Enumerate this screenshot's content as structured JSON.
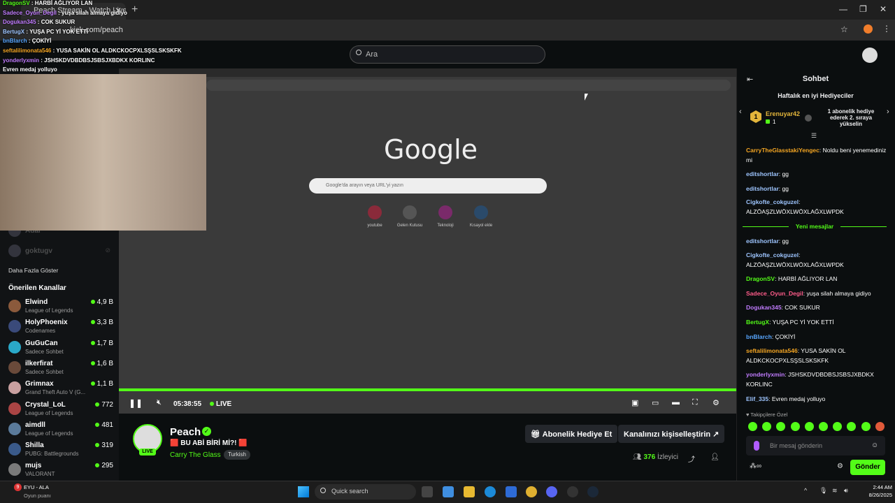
{
  "browser": {
    "tab_title": "Peach Stream - Watch Live on...",
    "url": "kick.com/peach"
  },
  "header": {
    "search_placeholder": "Ara"
  },
  "overlay_chat": [
    {
      "user": "DragonSV",
      "text": "HARBİ AĞLIYOR LAN"
    },
    {
      "user": "Sadece_Oyun_Degil",
      "text": "yuşa silah almaya gidiyo"
    },
    {
      "user": "Dogukan345",
      "text": "COK SUKUR"
    },
    {
      "user": "BertugX",
      "text": "YUŞA PC Yİ YOK ETTİ"
    },
    {
      "user": "bnBlarch",
      "text": "ÇOKİYİ"
    },
    {
      "user": "seftalilimonata546",
      "text": "YUSA SAKİN OL ALDKCKOCPXLSŞSLSKSKFK"
    },
    {
      "user": "yonderlyxmin",
      "text": "JSHSKDVDBDBSJSBSJXBDKX KORLINC"
    },
    {
      "user": "",
      "text": "Evren medaj yolluyo"
    }
  ],
  "sidebar": {
    "following": [
      {
        "name": "Adal"
      },
      {
        "name": "goktugv"
      }
    ],
    "show_more": "Daha Fazla Göster",
    "recommended_title": "Önerilen Kanallar",
    "recommended": [
      {
        "name": "Elwind",
        "category": "League of Legends",
        "viewers": "4,9 B"
      },
      {
        "name": "HolyPhoenix",
        "category": "Codenames",
        "viewers": "3,3 B"
      },
      {
        "name": "GuGuCan",
        "category": "Sadece Sohbet",
        "viewers": "1,7 B"
      },
      {
        "name": "ilkerfirat",
        "category": "Sadece Sohbet",
        "viewers": "1,6 B"
      },
      {
        "name": "Grimnax",
        "category": "Grand Theft Auto V (G...",
        "viewers": "1,1 B"
      },
      {
        "name": "Crystal_LoL",
        "category": "League of Legends",
        "viewers": "772"
      },
      {
        "name": "aimdll",
        "category": "League of Legends",
        "viewers": "481"
      },
      {
        "name": "Shilla",
        "category": "PUBG: Battlegrounds",
        "viewers": "319"
      },
      {
        "name": "mujs",
        "category": "VALORANT",
        "viewers": "295"
      }
    ]
  },
  "player": {
    "google_logo": "Google",
    "google_search_placeholder": "Google'da arayın veya URL'yi yazın",
    "shortcuts": [
      "youtube",
      "Gelen Kutusu",
      "Teknoloji",
      "Kısayol ekle"
    ],
    "elapsed": "05:38:55",
    "live_label": "LIVE"
  },
  "stream": {
    "streamer": "Peach",
    "live_badge": "LIVE",
    "title": "🟥 BU ABİ BİRİ Mİ?! 🟥",
    "category": "Carry The Glass",
    "language": "Turkish",
    "gift_sub_button": "Abonelik Hediye Et",
    "customize_button": "Kanalınızı kişiselleştirin",
    "viewer_count": "376",
    "viewer_label": "İzleyici"
  },
  "chat": {
    "title": "Sohbet",
    "gifters_title": "Haftalık en iyi Hediyeciler",
    "top_gifter": {
      "name": "Erenuyar42",
      "count": "1",
      "rank": "1"
    },
    "gifter_cta": "1 abonelik hediye ederek 2. sıraya yükselin",
    "new_messages": "Yeni mesajlar",
    "messages_before": [
      {
        "user": "CarryTheGlasstakiYengec",
        "color": "#f5a623",
        "text": "Noldu beni yenemediniz mi"
      },
      {
        "user": "editshortlar",
        "color": "#9ec5ff",
        "text": "gg"
      },
      {
        "user": "editshortlar",
        "color": "#9ec5ff",
        "text": "gg"
      },
      {
        "user": "Cigkofte_cokguzel",
        "color": "#9ec5ff",
        "text": "ALZÖAŞZLWÖXLWÖXLAĞXLWPDK"
      }
    ],
    "messages_after": [
      {
        "user": "editshortlar",
        "color": "#9ec5ff",
        "text": "gg"
      },
      {
        "user": "Cigkofte_cokguzel",
        "color": "#9ec5ff",
        "text": "ALZÖAŞZLWÖXLWÖXLAĞXLWPDK"
      },
      {
        "user": "DragonSV",
        "color": "#53fc18",
        "text": "HARBİ AĞLIYOR LAN"
      },
      {
        "user": "Sadece_Oyun_Degil",
        "color": "#ff5c8a",
        "text": "yuşa silah almaya gidiyo"
      },
      {
        "user": "Dogukan345",
        "color": "#c17cff",
        "text": "COK SUKUR"
      },
      {
        "user": "BertugX",
        "color": "#53fc18",
        "text": "YUŞA PC Yİ YOK ETTİ"
      },
      {
        "user": "bnBlarch",
        "color": "#58a6ff",
        "text": "ÇOKİYİ"
      },
      {
        "user": "seftalilimonata546",
        "color": "#f5a623",
        "text": "YUSA SAKİN OL ALDKCKOCPXLSŞSLSKSKFK"
      },
      {
        "user": "yonderlyxmin",
        "color": "#c17cff",
        "text": "JSHSKDVDBDBSJSBSJXBDKX KORLINC"
      },
      {
        "user": "Elif_335",
        "color": "#9ec5ff",
        "text": "Evren medaj yolluyo"
      }
    ],
    "follower_only_label": "Takipçilere Özel",
    "input_placeholder": "Bir mesaj gönderin",
    "send_button": "Gönder"
  },
  "taskbar": {
    "notification_count": "9",
    "now_playing_title": "EYU - ALA",
    "now_playing_sub": "Oyun puanı",
    "search_placeholder": "Quick search",
    "time": "2:44 AM",
    "date": "8/26/2025"
  },
  "colors": {
    "accent": "#53fc18",
    "background": "#0b0e0f"
  }
}
